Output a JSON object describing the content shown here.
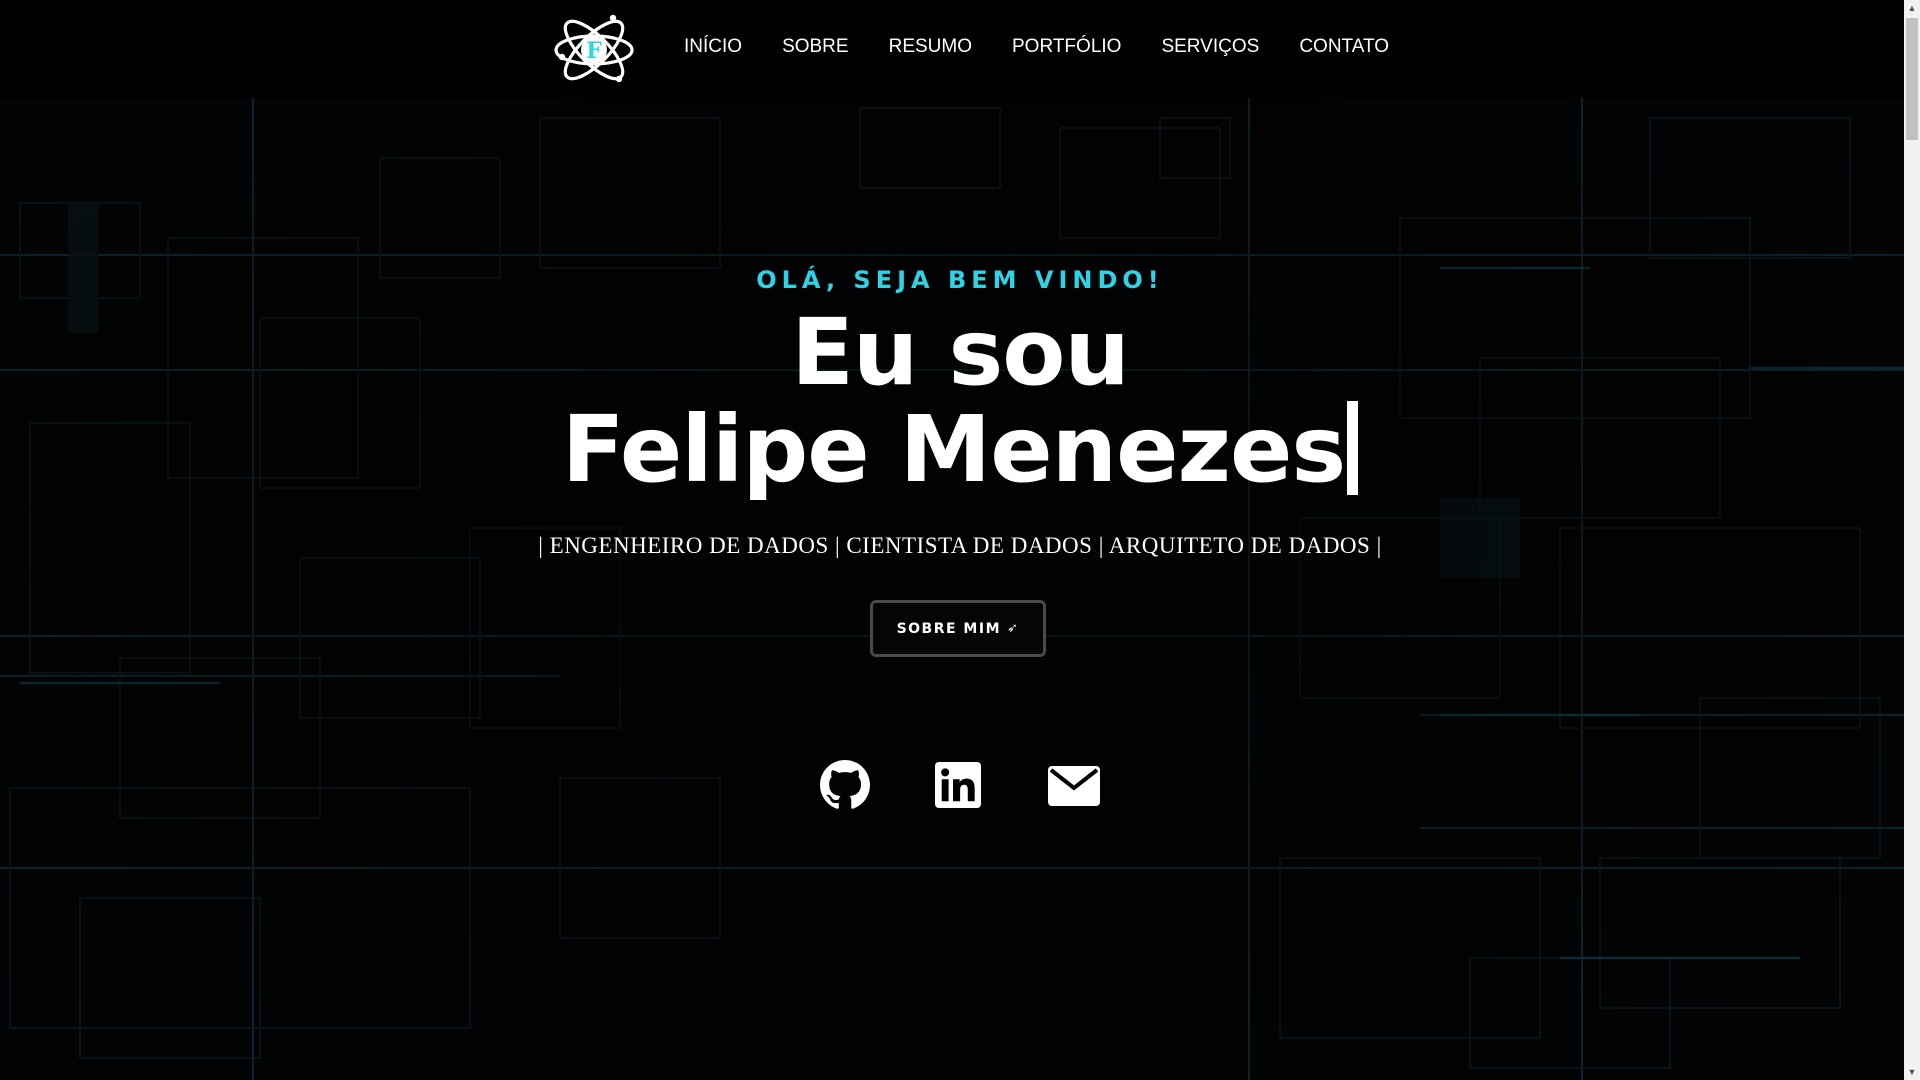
{
  "nav": {
    "logo_letter": "F",
    "items": [
      {
        "label": "INÍCIO"
      },
      {
        "label": "SOBRE"
      },
      {
        "label": "RESUMO"
      },
      {
        "label": "PORTFÓLIO"
      },
      {
        "label": "SERVIÇOS"
      },
      {
        "label": "CONTATO"
      }
    ]
  },
  "hero": {
    "greeting": "OLÁ, SEJA BEM VINDO!",
    "headline_line1": "Eu sou",
    "headline_line2": "Felipe Menezes",
    "roles": "| ENGENHEIRO DE DADOS | CIENTISTA DE DADOS | ARQUITETO DE DADOS |",
    "button_label": "SOBRE MIM",
    "button_arrow": "➶"
  },
  "socials": [
    {
      "icon": "github-icon"
    },
    {
      "icon": "linkedin-icon"
    },
    {
      "icon": "email-icon"
    }
  ],
  "colors": {
    "accent": "#2ed3e6",
    "background": "#020304",
    "text": "#ffffff"
  }
}
